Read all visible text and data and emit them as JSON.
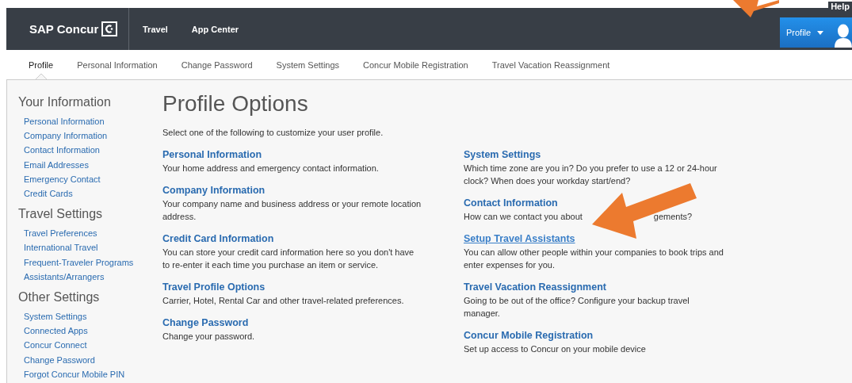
{
  "header": {
    "logo": "SAP Concur",
    "nav": [
      "Travel",
      "App Center"
    ],
    "help": "Help",
    "profile_button": "Profile"
  },
  "tabs": [
    {
      "label": "Profile",
      "selected": true
    },
    {
      "label": "Personal Information",
      "selected": false
    },
    {
      "label": "Change Password",
      "selected": false
    },
    {
      "label": "System Settings",
      "selected": false
    },
    {
      "label": "Concur Mobile Registration",
      "selected": false
    },
    {
      "label": "Travel Vacation Reassignment",
      "selected": false
    }
  ],
  "sidebar": [
    {
      "heading": "Your Information",
      "items": [
        "Personal Information",
        "Company Information",
        "Contact Information",
        "Email Addresses",
        "Emergency Contact",
        "Credit Cards"
      ]
    },
    {
      "heading": "Travel Settings",
      "items": [
        "Travel Preferences",
        "International Travel",
        "Frequent-Traveler Programs",
        "Assistants/Arrangers"
      ]
    },
    {
      "heading": "Other Settings",
      "items": [
        "System Settings",
        "Connected Apps",
        "Concur Connect",
        "Change Password",
        "Forgot Concur Mobile PIN"
      ]
    }
  ],
  "main": {
    "title": "Profile Options",
    "intro": "Select one of the following to customize your user profile.",
    "columns": [
      [
        {
          "title": "Personal Information",
          "description": [
            "Your home address and emergency contact information."
          ]
        },
        {
          "title": "Company Information",
          "description": [
            "Your company name and business address or your remote location address."
          ]
        },
        {
          "title": "Credit Card Information",
          "description": [
            "You can store your credit card information here so you don't have to re-enter it each time you purchase an item or service."
          ]
        },
        {
          "title": "Travel Profile Options",
          "description": [
            "Carrier, Hotel, Rental Car and other travel-related preferences."
          ]
        },
        {
          "title": "Change Password",
          "description": [
            "Change your password."
          ]
        }
      ],
      [
        {
          "title": "System Settings",
          "description": [
            "Which time zone are you in? Do you prefer to use a 12 or 24-hour clock? When does your workday start/end?"
          ]
        },
        {
          "title": "Contact Information",
          "description": [
            "How can we contact you about",
            "gements?"
          ]
        },
        {
          "title": "Setup Travel Assistants",
          "hovered": true,
          "description": [
            "You can allow other people within your companies to book trips and enter expenses for you."
          ]
        },
        {
          "title": "Travel Vacation Reassignment",
          "description": [
            "Going to be out of the office? Configure your backup travel manager."
          ]
        },
        {
          "title": "Concur Mobile Registration",
          "description": [
            "Set up access to Concur on your mobile device"
          ]
        }
      ]
    ]
  }
}
